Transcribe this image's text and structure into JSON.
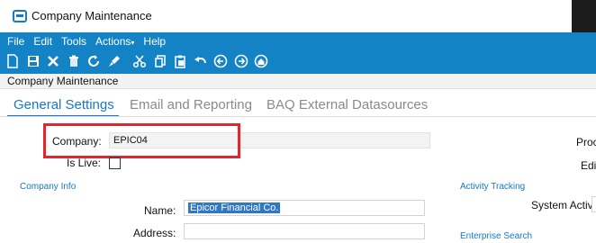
{
  "window": {
    "title": "Company Maintenance"
  },
  "menubar": {
    "items": [
      "File",
      "Edit",
      "Tools",
      "Actions",
      "Help"
    ],
    "actions_caret": "▾"
  },
  "toolbar": {
    "buttons": [
      "new-icon",
      "save-icon",
      "delete-icon",
      "trash-icon",
      "refresh-icon",
      "clear-icon",
      "cut-icon",
      "copy-icon",
      "paste-icon",
      "undo-icon",
      "back-icon",
      "forward-icon",
      "home-icon"
    ]
  },
  "form": {
    "label": "Company Maintenance"
  },
  "tabs": [
    {
      "label": "General Settings",
      "active": true
    },
    {
      "label": "Email and Reporting",
      "active": false
    },
    {
      "label": "BAQ External Datasources",
      "active": false
    }
  ],
  "general": {
    "company_label": "Company:",
    "company_value": "EPIC04",
    "is_live_label": "Is Live:",
    "company_info_header": "Company Info",
    "name_label": "Name:",
    "name_value": "Epicor Financial Co.",
    "address_label": "Address:",
    "address_value": "",
    "activity_tracking_header": "Activity Tracking",
    "system_activity_label": "System Activi",
    "enterprise_search_header": "Enterprise Search",
    "prod_label": "Proc",
    "edit_label": "Edi"
  },
  "colors": {
    "chrome": "#1383c6",
    "accent": "#1679c4",
    "highlight": "#e3252d"
  }
}
